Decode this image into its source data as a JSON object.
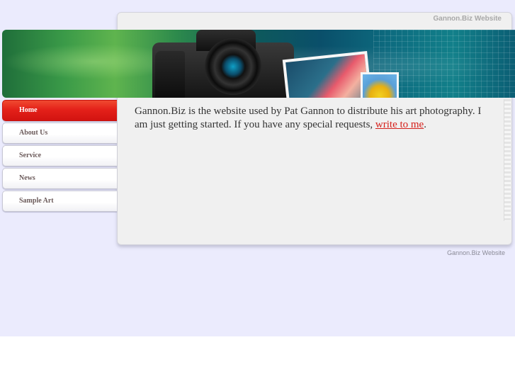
{
  "site": {
    "top_title": "Gannon.Biz Website",
    "footer_title": "Gannon.Biz Website"
  },
  "nav": {
    "items": [
      {
        "label": "Home",
        "active": true
      },
      {
        "label": "About Us",
        "active": false
      },
      {
        "label": "Service",
        "active": false
      },
      {
        "label": "News",
        "active": false
      },
      {
        "label": "Sample Art",
        "active": false
      }
    ]
  },
  "content": {
    "intro_text": "Gannon.Biz is the website used by Pat Gannon to distribute his art photography.  I am just getting started.  If you have any special requests, ",
    "link_text": "write to me",
    "trailing_text": "."
  },
  "colors": {
    "page_bg": "#ebebfd",
    "accent_red": "#e4211a",
    "link_red": "#d5201b"
  }
}
